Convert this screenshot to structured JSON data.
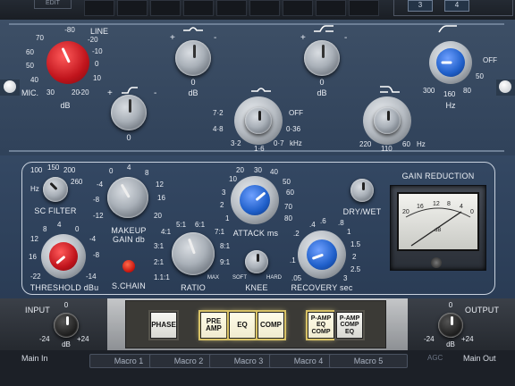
{
  "top_bar": {
    "edit": "EDIT",
    "tab_3": "3",
    "tab_4": "4"
  },
  "eq": {
    "line_label": "LINE",
    "mic_label": "MIC.",
    "line_ticks": [
      "70",
      "-80",
      "-20",
      "60",
      "-10",
      "50",
      "0",
      "40",
      "10",
      "30",
      "20",
      "-20"
    ],
    "db": "dB",
    "hz": "Hz",
    "khz": "kHz",
    "off": "OFF",
    "hs_scale": [
      "300",
      "160",
      "80",
      "50",
      "OFF"
    ],
    "lf_freq": [
      "220",
      "110",
      "60"
    ],
    "mf_freq": [
      "7·2",
      "4·8",
      "3·2",
      "1·6",
      "0·7",
      "0·36",
      "OFF"
    ],
    "plus": "+",
    "minus": "-",
    "zero": "0"
  },
  "comp": {
    "sc_filter": "SC FILTER",
    "sc_scale": [
      "100",
      "150",
      "200",
      "260"
    ],
    "sc_hz": "Hz",
    "makeup": "MAKEUP",
    "gain_db": "GAIN db",
    "makeup_scale": [
      "0",
      "4",
      "8",
      "12",
      "16",
      "20",
      "-4",
      "-8",
      "-12"
    ],
    "attack": "ATTACK ms",
    "attack_scale": [
      "10",
      "20",
      "30",
      "40",
      "50",
      "60",
      "70",
      "80",
      "3",
      "2",
      "1"
    ],
    "dry_wet": "DRY/WET",
    "gr_title": "GAIN REDUCTION",
    "gr_scale": [
      "20",
      "16",
      "12",
      "8",
      "4",
      "0"
    ],
    "gr_db": "dB",
    "threshold": "THRESHOLD dBu",
    "threshold_scale": [
      "12",
      "8",
      "4",
      "0",
      "-4",
      "-8",
      "16",
      "-14",
      "-22"
    ],
    "schain": "S.CHAIN",
    "ratio": "RATIO",
    "ratio_scale": [
      "4:1",
      "5:1",
      "6:1",
      "7:1",
      "8:1",
      "9:1",
      "3:1",
      "2:1",
      "1.1:1",
      "MAX"
    ],
    "knee": "KNEE",
    "soft": "SOFT",
    "hard": "HARD",
    "recovery": "RECOVERY sec",
    "recovery_scale": [
      ".4",
      ".6",
      ".8",
      "1",
      "1.5",
      "2",
      "2.5",
      "3",
      ".2",
      ".1",
      ".05"
    ]
  },
  "bottom": {
    "input": "INPUT",
    "output": "OUTPUT",
    "in_db": [
      "-24",
      "dB",
      "+24"
    ],
    "in_zero": "0",
    "buttons": [
      "PHASE",
      "PRE AMP",
      "EQ",
      "COMP",
      "P-AMP EQ COMP",
      "P-AMP COMP EQ"
    ]
  },
  "footer": {
    "main_in": "Main In",
    "main_out": "Main Out",
    "agc": "AGC",
    "macros": [
      "Macro 1",
      "Macro 2",
      "Macro 3",
      "Macro 4",
      "Macro 5"
    ]
  }
}
